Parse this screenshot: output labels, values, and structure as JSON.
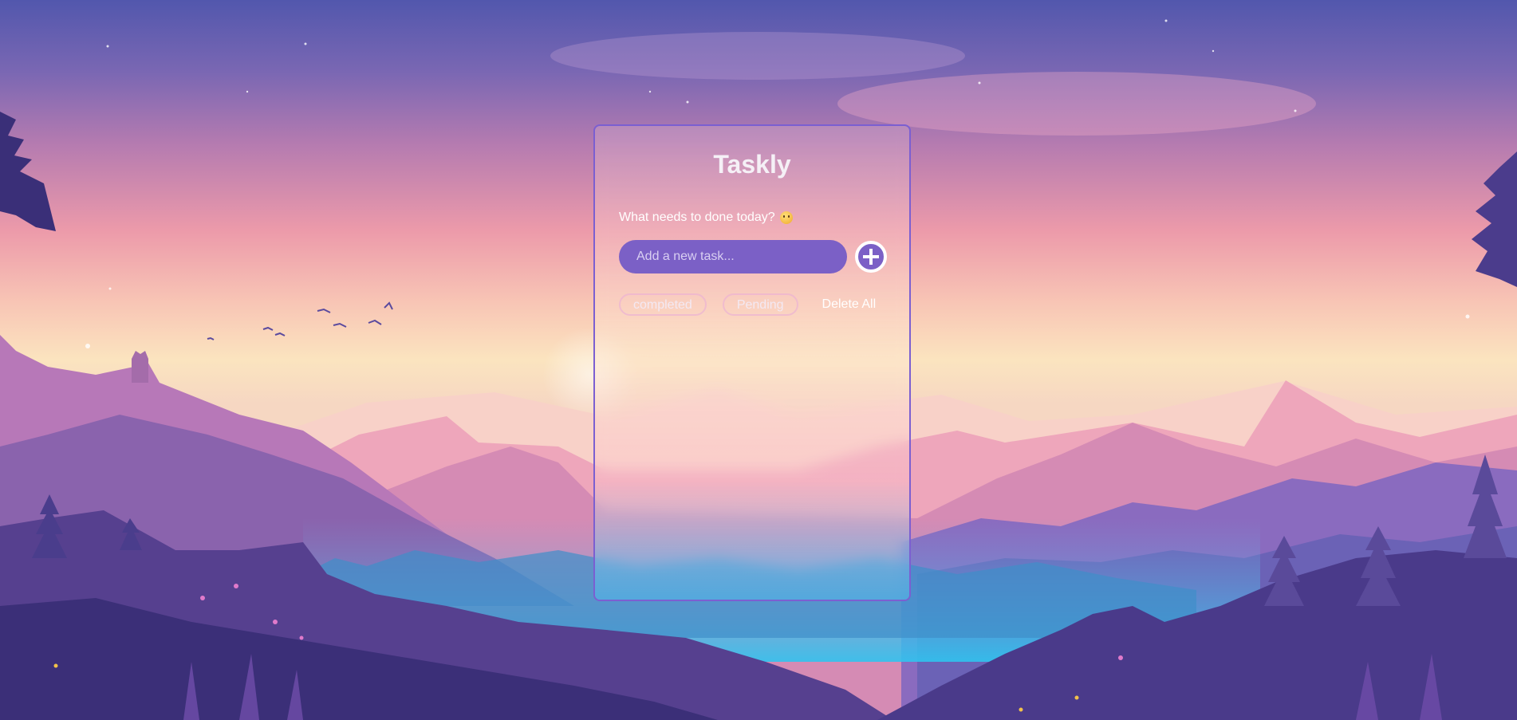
{
  "app": {
    "title": "Taskly",
    "prompt": "What needs to done today?",
    "prompt_emoji": "thinking-face-emoji"
  },
  "input": {
    "placeholder": "Add a new task...",
    "value": ""
  },
  "add_button": {
    "icon": "plus-icon"
  },
  "filters": {
    "completed_label": "completed",
    "pending_label": "Pending",
    "delete_all_label": "Delete All"
  },
  "colors": {
    "accent": "#7b60c6",
    "panel_border": "#7b5fd1",
    "chip_border": "#ecb4d2"
  }
}
